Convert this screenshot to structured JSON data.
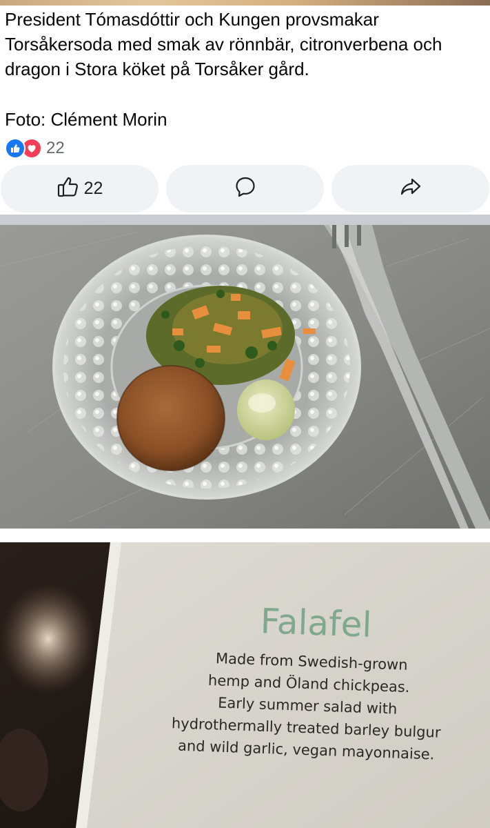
{
  "post": {
    "caption_lines": [
      "President Tómasdóttir och Kungen provsmakar",
      "Torsåkersoda med smak av rönnbär, citronverbena och",
      "dragon i Stora köket på Torsåker gård."
    ],
    "credit": "Foto: Clément Morin"
  },
  "reactions": {
    "count": "22",
    "icons": [
      "like-icon",
      "love-icon"
    ]
  },
  "actions": {
    "like_count": "22",
    "like_icon": "thumbs-up-icon",
    "comment_icon": "comment-bubble-icon",
    "share_icon": "share-arrow-icon"
  },
  "menu_card": {
    "title": "Falafel",
    "lines": [
      "Made from Swedish-grown",
      "hemp and Öland chickpeas.",
      "Early summer salad with",
      "hydrothermally treated barley bulgur",
      "and wild garlic, vegan mayonnaise."
    ]
  },
  "colors": {
    "like_blue": "#1877f2",
    "love_red": "#f33e58",
    "button_bg": "#f0f2f5",
    "menu_title_green": "#7fa88c"
  }
}
